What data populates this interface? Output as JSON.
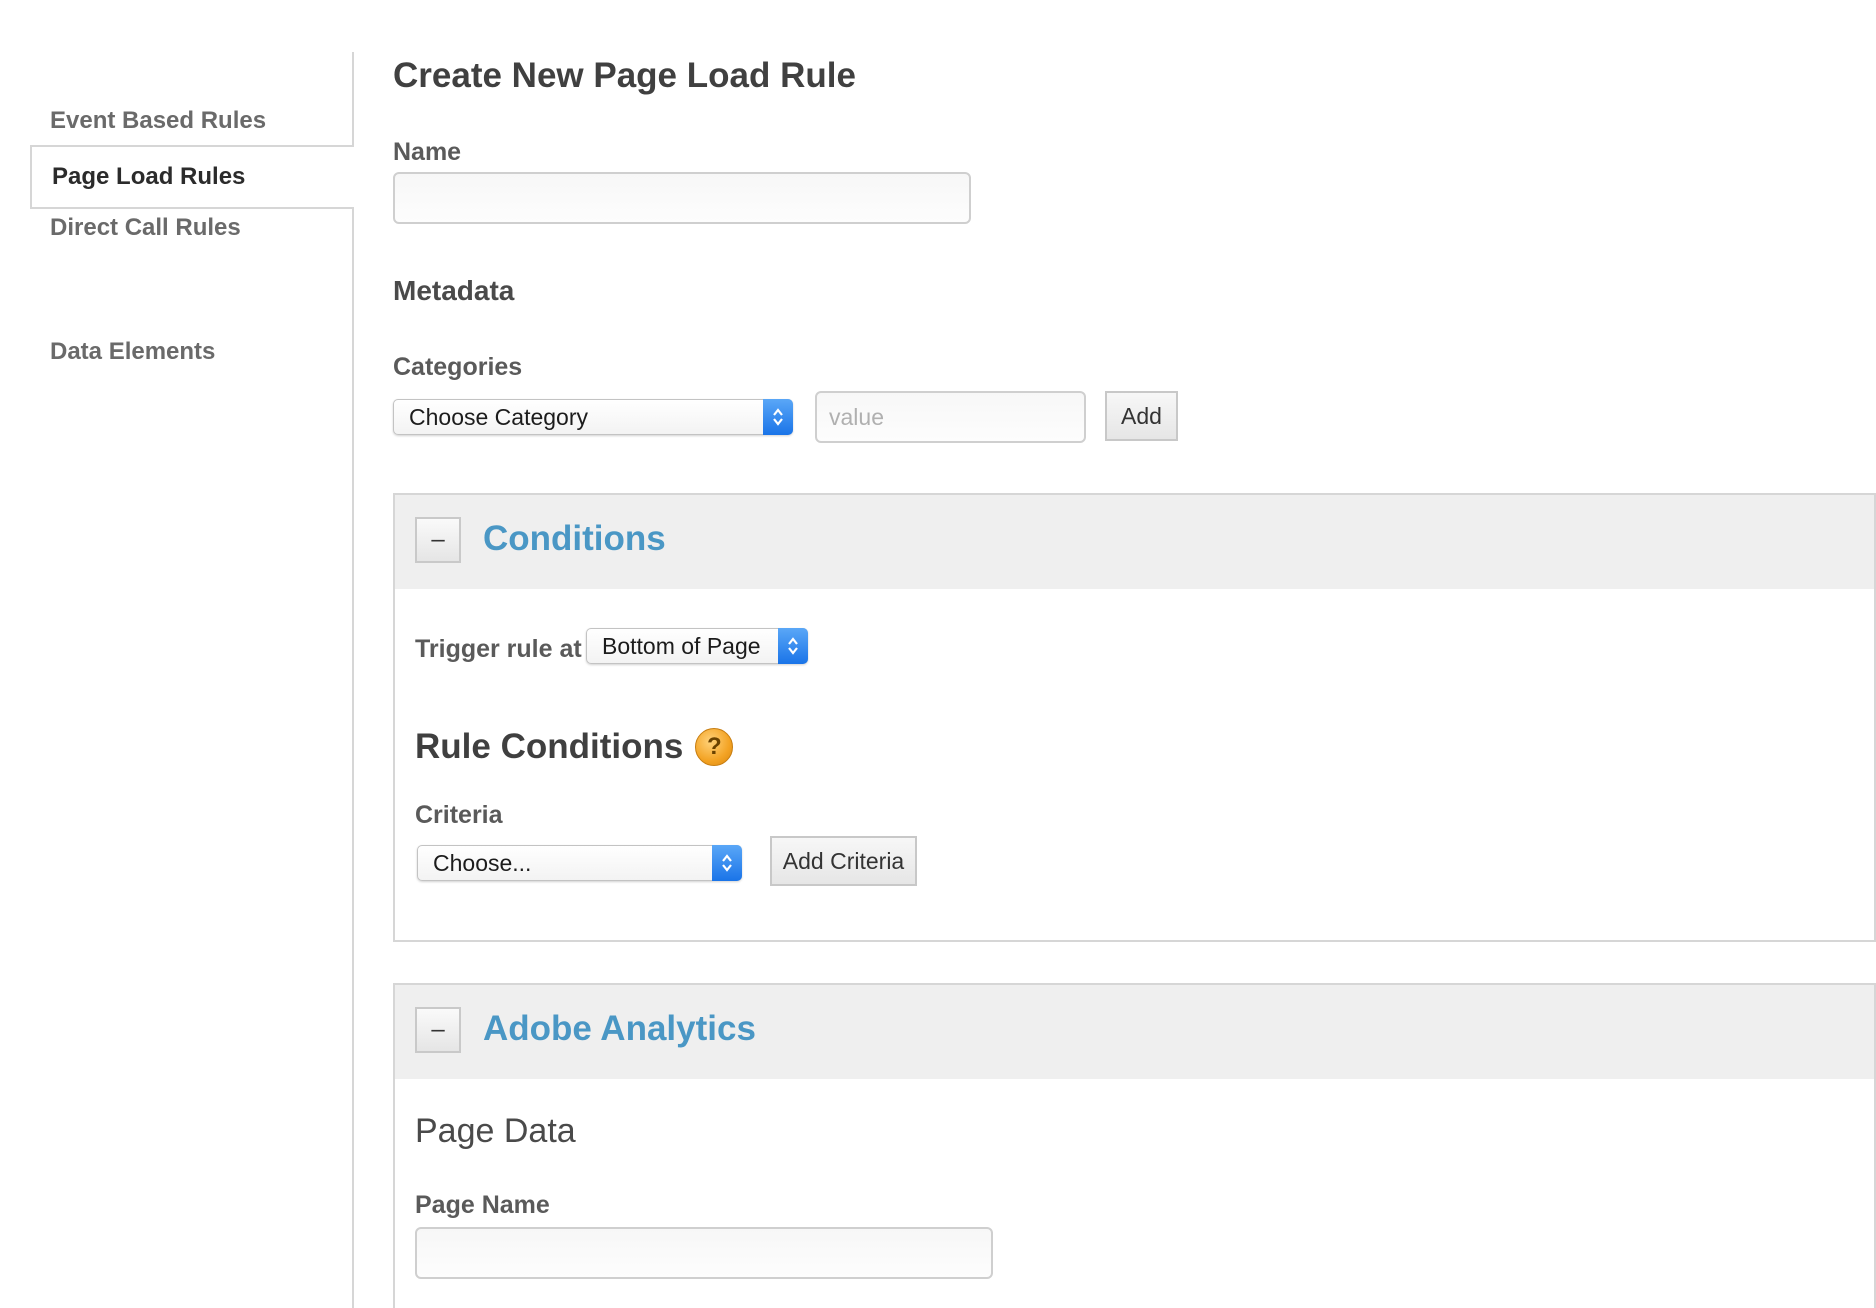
{
  "sidebar": {
    "items": [
      {
        "label": "Event Based Rules"
      },
      {
        "label": "Page Load Rules"
      },
      {
        "label": "Direct Call Rules"
      },
      {
        "label": "Data Elements"
      }
    ]
  },
  "main": {
    "title": "Create New Page Load Rule",
    "name_label": "Name",
    "name_value": "",
    "metadata_heading": "Metadata",
    "categories_label": "Categories",
    "category_select": "Choose Category",
    "value_placeholder": "value",
    "add_label": "Add"
  },
  "conditions": {
    "collapse_label": "–",
    "title": "Conditions",
    "trigger_label": "Trigger rule at",
    "trigger_select": "Bottom of Page",
    "rule_conditions_heading": "Rule Conditions",
    "help_icon": "?",
    "criteria_label": "Criteria",
    "criteria_select": "Choose...",
    "add_criteria_label": "Add Criteria"
  },
  "analytics": {
    "collapse_label": "–",
    "title": "Adobe Analytics",
    "page_data_heading": "Page Data",
    "page_name_label": "Page Name",
    "page_name_value": ""
  },
  "colors": {
    "panel_title": "#4a97c5",
    "select_arrow": "#1a74e8",
    "help_icon": "#f3a324"
  }
}
